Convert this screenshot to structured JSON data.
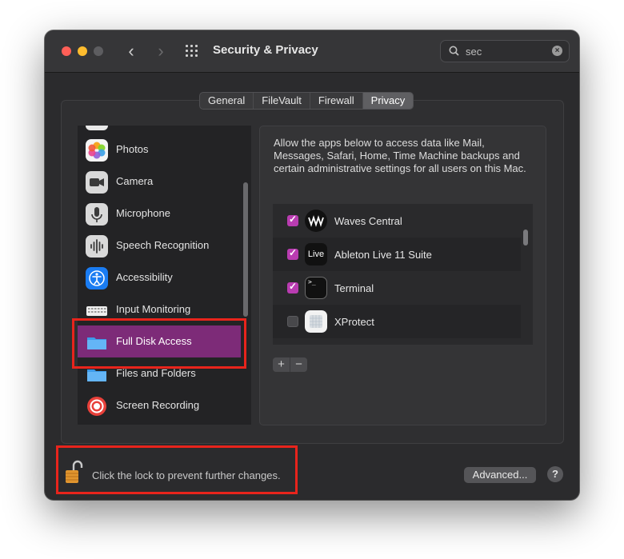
{
  "window": {
    "title": "Security & Privacy",
    "search": {
      "value": "sec",
      "clear_label": "×"
    },
    "nav": {
      "back": "‹",
      "forward": "›"
    }
  },
  "tabs": [
    {
      "label": "General",
      "active": false
    },
    {
      "label": "FileVault",
      "active": false
    },
    {
      "label": "Firewall",
      "active": false
    },
    {
      "label": "Privacy",
      "active": true
    }
  ],
  "privacy_categories": [
    {
      "label": "Photos",
      "icon": "photos-icon"
    },
    {
      "label": "Camera",
      "icon": "camera-icon"
    },
    {
      "label": "Microphone",
      "icon": "microphone-icon"
    },
    {
      "label": "Speech Recognition",
      "icon": "speech-recognition-icon"
    },
    {
      "label": "Accessibility",
      "icon": "accessibility-icon"
    },
    {
      "label": "Input Monitoring",
      "icon": "keyboard-icon"
    },
    {
      "label": "Full Disk Access",
      "icon": "folder-icon",
      "selected": true
    },
    {
      "label": "Files and Folders",
      "icon": "folder-icon"
    },
    {
      "label": "Screen Recording",
      "icon": "screen-recording-icon"
    }
  ],
  "description": "Allow the apps below to access data like Mail, Messages, Safari, Home, Time Machine backups and certain administrative settings for all users on this Mac.",
  "apps": [
    {
      "name": "Waves Central",
      "checked": true,
      "icon": "waves-icon"
    },
    {
      "name": "Ableton Live 11 Suite",
      "checked": true,
      "icon": "ableton-live-icon",
      "icon_text": "Live"
    },
    {
      "name": "Terminal",
      "checked": true,
      "icon": "terminal-icon",
      "icon_text": ">_"
    },
    {
      "name": "XProtect",
      "checked": false,
      "icon": "xprotect-icon"
    }
  ],
  "buttons": {
    "add": "+",
    "remove": "−",
    "advanced": "Advanced...",
    "help": "?"
  },
  "lock_text": "Click the lock to prevent further changes.",
  "colors": {
    "selection": "#7d2b78",
    "checkbox_on": "#b93cb1",
    "highlight": "#e8241c"
  }
}
